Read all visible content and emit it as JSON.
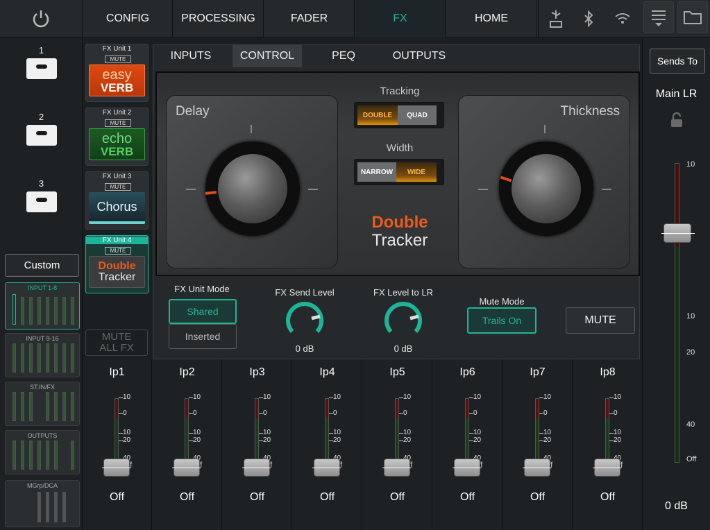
{
  "topbar": {
    "tabs": [
      {
        "label": "CONFIG"
      },
      {
        "label": "PROCESSING"
      },
      {
        "label": "FADER"
      },
      {
        "label": "FX"
      },
      {
        "label": "HOME"
      }
    ],
    "active_tab": "FX",
    "icons": [
      "power-icon",
      "usb-storage-icon",
      "bluetooth-icon",
      "wifi-icon",
      "menu-icon",
      "folder-icon"
    ]
  },
  "left": {
    "slots": [
      {
        "num": "1"
      },
      {
        "num": "2"
      },
      {
        "num": "3"
      }
    ],
    "custom_label": "Custom",
    "banks": [
      {
        "label": "INPUT 1-8"
      },
      {
        "label": "INPUT 9-16"
      },
      {
        "label": "ST.IN/FX"
      },
      {
        "label": "OUTPUTS"
      },
      {
        "label": "MGrp/DCA"
      }
    ]
  },
  "fx_units": [
    {
      "title": "FX Unit 1",
      "mute": "MUTE",
      "line1": "easy",
      "line2": "VERB"
    },
    {
      "title": "FX Unit 2",
      "mute": "MUTE",
      "line1": "echo",
      "line2": "VERB"
    },
    {
      "title": "FX Unit 3",
      "mute": "MUTE",
      "line1": "Chorus",
      "line2": ""
    },
    {
      "title": "FX Unit 4",
      "mute": "MUTE",
      "line1": "Double",
      "line2": "Tracker"
    }
  ],
  "mute_all": {
    "line1": "MUTE",
    "line2": "ALL FX"
  },
  "panel": {
    "subtabs": [
      {
        "label": "INPUTS"
      },
      {
        "label": "CONTROL"
      },
      {
        "label": "PEQ"
      },
      {
        "label": "OUTPUTS"
      }
    ],
    "active_subtab": "CONTROL",
    "pedal": {
      "delay_label": "Delay",
      "thickness_label": "Thickness",
      "tracking_label": "Tracking",
      "tracking_options": [
        "DOUBLE",
        "QUAD"
      ],
      "tracking_selected": "DOUBLE",
      "width_label": "Width",
      "width_options": [
        "NARROW",
        "WIDE"
      ],
      "width_selected": "WIDE",
      "logo_line1": "Double",
      "logo_line2": "Tracker"
    },
    "fx_unit_mode_label": "FX Unit Mode",
    "fx_unit_mode_options": [
      "Shared",
      "Inserted"
    ],
    "fx_unit_mode_selected": "Shared",
    "fx_send_level_label": "FX Send Level",
    "fx_send_level_value": "0 dB",
    "fx_level_to_lr_label": "FX Level to LR",
    "fx_level_to_lr_value": "0 dB",
    "mute_mode_label": "Mute Mode",
    "mute_mode_value": "Trails On",
    "mute_button": "MUTE"
  },
  "channels": [
    {
      "name": "Ip1",
      "value": "Off"
    },
    {
      "name": "Ip2",
      "value": "Off"
    },
    {
      "name": "Ip3",
      "value": "Off"
    },
    {
      "name": "Ip4",
      "value": "Off"
    },
    {
      "name": "Ip5",
      "value": "Off"
    },
    {
      "name": "Ip6",
      "value": "Off"
    },
    {
      "name": "Ip7",
      "value": "Off"
    },
    {
      "name": "Ip8",
      "value": "Off"
    }
  ],
  "channel_scale": [
    "10",
    "0",
    "10",
    "20",
    "40",
    "Off"
  ],
  "master": {
    "sends_to": "Sends To",
    "bus": "Main LR",
    "scale": [
      "10",
      "0",
      "10",
      "20",
      "40",
      "Off"
    ],
    "value": "0 dB"
  },
  "colors": {
    "accent": "#1fb49a",
    "orange": "#ec5a1e",
    "background": "#1c1f21"
  }
}
